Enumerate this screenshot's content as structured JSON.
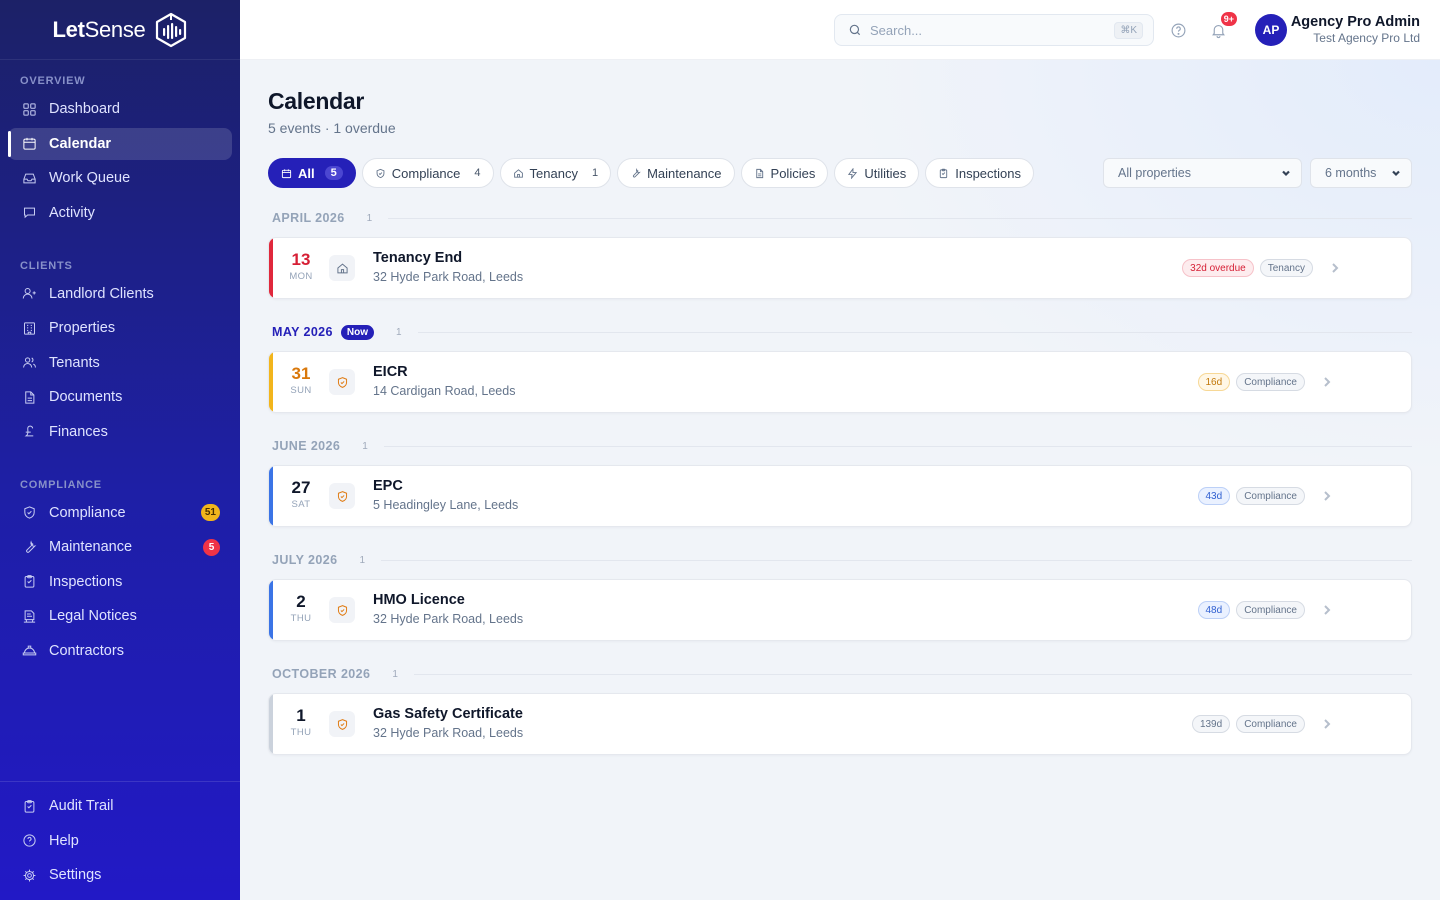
{
  "brand": {
    "name_bold": "Let",
    "name_rest": "Sense"
  },
  "sidebar": {
    "sections": [
      {
        "heading": "OVERVIEW",
        "items": [
          {
            "label": "Dashboard",
            "icon": "dashboard-icon"
          },
          {
            "label": "Calendar",
            "icon": "calendar-icon",
            "active": true
          },
          {
            "label": "Work Queue",
            "icon": "inbox-icon"
          },
          {
            "label": "Activity",
            "icon": "chat-icon"
          }
        ]
      },
      {
        "heading": "CLIENTS",
        "items": [
          {
            "label": "Landlord Clients",
            "icon": "user-icon"
          },
          {
            "label": "Properties",
            "icon": "building-icon"
          },
          {
            "label": "Tenants",
            "icon": "users-icon"
          },
          {
            "label": "Documents",
            "icon": "document-icon"
          },
          {
            "label": "Finances",
            "icon": "pound-icon"
          }
        ]
      },
      {
        "heading": "COMPLIANCE",
        "items": [
          {
            "label": "Compliance",
            "icon": "shield-icon",
            "badge": "51",
            "badge_color": "amber"
          },
          {
            "label": "Maintenance",
            "icon": "wrench-icon",
            "badge": "5",
            "badge_color": "red"
          },
          {
            "label": "Inspections",
            "icon": "clipboard-icon"
          },
          {
            "label": "Legal Notices",
            "icon": "notice-icon"
          },
          {
            "label": "Contractors",
            "icon": "hardhat-icon"
          }
        ]
      }
    ],
    "footer": [
      {
        "label": "Audit Trail",
        "icon": "clipboard-icon"
      },
      {
        "label": "Help",
        "icon": "help-icon"
      },
      {
        "label": "Settings",
        "icon": "gear-icon"
      }
    ]
  },
  "topbar": {
    "search_placeholder": "Search...",
    "search_shortcut": "⌘K",
    "notification_badge": "9+",
    "avatar_initials": "AP",
    "user_name": "Agency Pro Admin",
    "user_org": "Test Agency Pro Ltd"
  },
  "page": {
    "title": "Calendar",
    "subtitle": "5 events · 1 overdue"
  },
  "filters": [
    {
      "label": "All",
      "count": "5",
      "active": true,
      "icon": "calendar-icon"
    },
    {
      "label": "Compliance",
      "count": "4",
      "icon": "shield-icon"
    },
    {
      "label": "Tenancy",
      "count": "1",
      "icon": "home-icon"
    },
    {
      "label": "Maintenance",
      "count": "",
      "icon": "wrench-icon"
    },
    {
      "label": "Policies",
      "count": "",
      "icon": "document-icon"
    },
    {
      "label": "Utilities",
      "count": "",
      "icon": "bolt-icon"
    },
    {
      "label": "Inspections",
      "count": "",
      "icon": "clipboard-icon"
    }
  ],
  "property_filter": {
    "value": "All properties"
  },
  "range_filter": {
    "value": "6 months"
  },
  "months": [
    {
      "label": "APRIL 2026",
      "count": "1",
      "now": false,
      "events": [
        {
          "day": "13",
          "dow": "MON",
          "title": "Tenancy End",
          "address": "32 Hyde Park Road, Leeds",
          "status": "32d overdue",
          "status_tone": "red",
          "category": "Tenancy",
          "icon": "home-icon",
          "accent": "#e0283c",
          "day_color": "#d61f35"
        }
      ]
    },
    {
      "label": "MAY 2026",
      "count": "1",
      "now": true,
      "now_label": "Now",
      "events": [
        {
          "day": "31",
          "dow": "SUN",
          "title": "EICR",
          "address": "14 Cardigan Road, Leeds",
          "status": "16d",
          "status_tone": "amber",
          "category": "Compliance",
          "icon": "shield-icon",
          "accent": "#f2b51c",
          "day_color": "#d9780b"
        }
      ]
    },
    {
      "label": "JUNE 2026",
      "count": "1",
      "now": false,
      "events": [
        {
          "day": "27",
          "dow": "SAT",
          "title": "EPC",
          "address": "5 Headingley Lane, Leeds",
          "status": "43d",
          "status_tone": "blue",
          "category": "Compliance",
          "icon": "shield-icon",
          "accent": "#3b74e6",
          "day_color": "#0f172a"
        }
      ]
    },
    {
      "label": "JULY 2026",
      "count": "1",
      "now": false,
      "events": [
        {
          "day": "2",
          "dow": "THU",
          "title": "HMO Licence",
          "address": "32 Hyde Park Road, Leeds",
          "status": "48d",
          "status_tone": "blue",
          "category": "Compliance",
          "icon": "shield-icon",
          "accent": "#3b74e6",
          "day_color": "#0f172a"
        }
      ]
    },
    {
      "label": "OCTOBER 2026",
      "count": "1",
      "now": false,
      "events": [
        {
          "day": "1",
          "dow": "THU",
          "title": "Gas Safety Certificate",
          "address": "32 Hyde Park Road, Leeds",
          "status": "139d",
          "status_tone": "gray",
          "category": "Compliance",
          "icon": "shield-icon",
          "accent": "#cbd2dc",
          "day_color": "#0f172a"
        }
      ]
    }
  ]
}
